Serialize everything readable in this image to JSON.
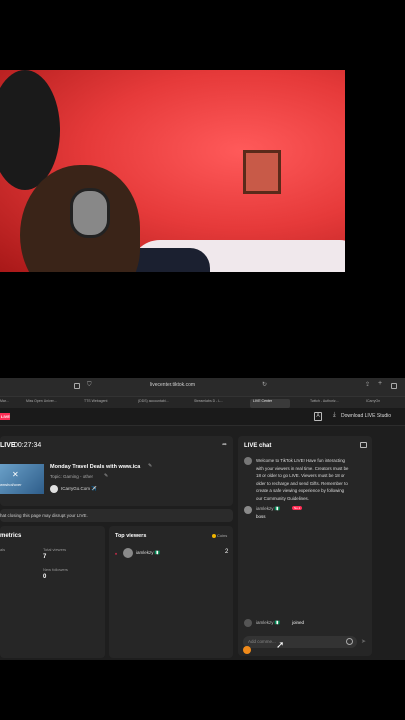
{
  "browser": {
    "url": "livecenter.tiktok.com",
    "tabs": [
      "Mar...",
      "Miss Open Univer...",
      "TTS Webagent",
      "(DDS) accountabi...",
      "Streamlabs D - L...",
      "LIVE Center",
      "Twitch - Authoriz...",
      "ICarryOn"
    ]
  },
  "app": {
    "live_badge": "LIVE",
    "download_label": "Download LIVE Studio",
    "status_live": "LIVE",
    "timer": "00:27:34",
    "stream_title": "Monday Travel Deals with www.ica",
    "topic": "Topic: Gaming - other",
    "channel": "ICarryGo.Com ✈️",
    "warning": "hat closing this page may disrupt your LIVE.",
    "thumb_label": "wnshot/over"
  },
  "metrics": {
    "title": "metrics",
    "left_label": "als",
    "total_viewers_label": "Total viewers",
    "total_viewers": "7",
    "new_followers_label": "New followers",
    "new_followers": "0"
  },
  "top_viewers": {
    "title": "Top viewers",
    "coins_label": "Coins",
    "rows": [
      {
        "name": "iamlekzy 🇳🇬",
        "value": "2"
      }
    ]
  },
  "chat": {
    "title": "LIVE chat",
    "welcome": [
      "Welcome to TikTok LIVE! Have fun interacting",
      "with your viewers in real time. Creators must be",
      "18 or older to go LIVE. Viewers must be 18 or",
      "older to recharge and send Gifts. Remember to",
      "create a safe viewing experience by following",
      "our Community Guidelines."
    ],
    "msg_user": "iamlekzy 🇳🇬",
    "msg_badge": "No.1",
    "msg_text": "boss",
    "join_user": "iamlekzy 🇳🇬",
    "join_text": "joined",
    "input_placeholder": "Add comme..."
  },
  "colors": {
    "accent": "#ff2d55",
    "panel": "#262626",
    "bg": "#1e1e1e"
  }
}
